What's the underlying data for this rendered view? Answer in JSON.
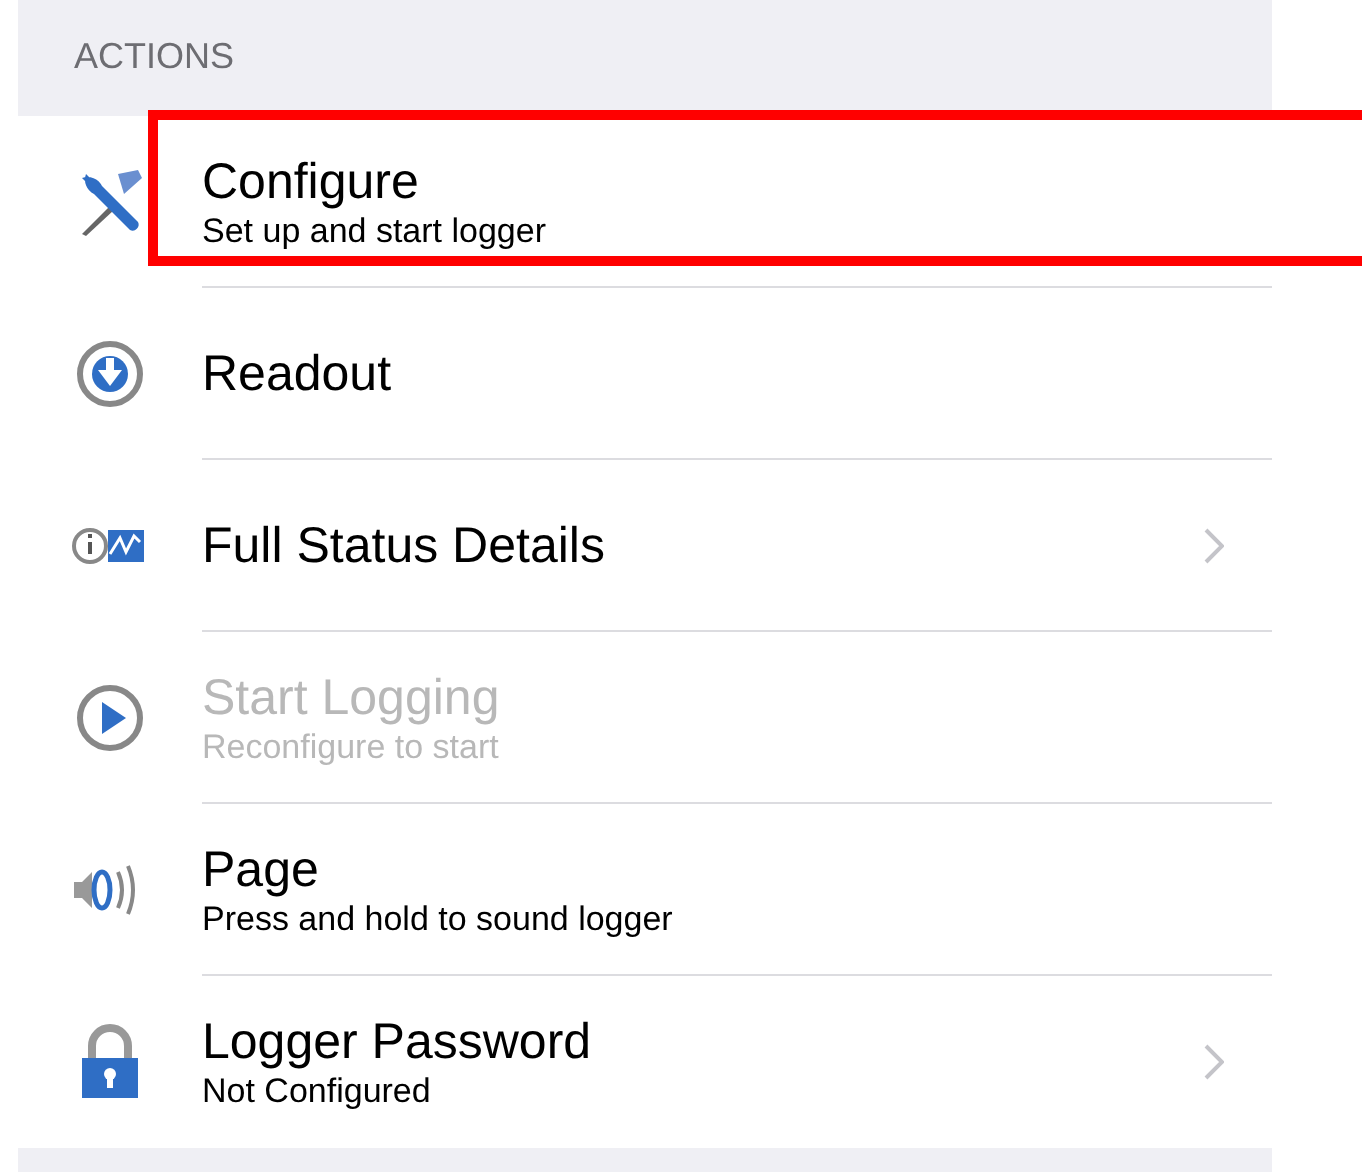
{
  "section_header": "ACTIONS",
  "items": [
    {
      "kind": "tools",
      "title": "Configure",
      "subtitle": "Set up and start logger",
      "disabled": false,
      "chevron": false,
      "highlighted": true
    },
    {
      "kind": "download",
      "title": "Readout",
      "disabled": false,
      "chevron": false,
      "highlighted": false
    },
    {
      "kind": "status",
      "title": "Full Status Details",
      "disabled": false,
      "chevron": true,
      "highlighted": false
    },
    {
      "kind": "play",
      "title": "Start Logging",
      "subtitle": "Reconfigure to start",
      "disabled": true,
      "chevron": false,
      "highlighted": false
    },
    {
      "kind": "sound",
      "title": "Page",
      "subtitle": "Press and hold to sound logger",
      "disabled": false,
      "chevron": false,
      "highlighted": false
    },
    {
      "kind": "lock",
      "title": "Logger Password",
      "subtitle": "Not Configured",
      "disabled": false,
      "chevron": true,
      "highlighted": false
    }
  ]
}
